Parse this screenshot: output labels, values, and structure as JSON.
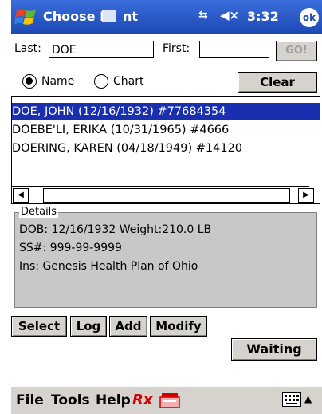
{
  "titlebar": {
    "title": "Choose P",
    "title_suffix": "nt",
    "time": "3:32",
    "ok_label": "ok",
    "conn_glyph": "⇆",
    "volume_glyph": "◀×",
    "logo_icon": "windows-flag-icon",
    "input_icon": "keyboard-indicator-icon"
  },
  "search": {
    "last_label": "Last:",
    "last_value": "DOE",
    "first_label": "First:",
    "first_value": "",
    "go_label": "GO!"
  },
  "mode": {
    "name_label": "Name",
    "chart_label": "Chart",
    "selected": "Name",
    "clear_label": "Clear"
  },
  "results": [
    {
      "text": "DOE, JOHN  (12/16/1932) #77684354",
      "selected": true
    },
    {
      "text": "DOEBE'LI, ERIKA   (10/31/1965) #4666",
      "selected": false
    },
    {
      "text": "DOERING, KAREN  (04/18/1949) #14120",
      "selected": false
    }
  ],
  "details": {
    "legend": "Details",
    "line1": "DOB: 12/16/1932 Weight:210.0 LB",
    "line2": "SS#: 999-99-9999",
    "line3": "Ins: Genesis Health Plan of Ohio"
  },
  "actions": {
    "select": "Select",
    "log": "Log",
    "add": "Add",
    "modify": "Modify",
    "waiting": "Waiting"
  },
  "menu": {
    "file": "File",
    "tools": "Tools",
    "help": "Help",
    "rx": "Rx"
  },
  "colors": {
    "title_bar": "#1d49b4",
    "selection": "#1a2fb0",
    "rx": "#d00000",
    "details_bg": "#c8c8c8"
  }
}
